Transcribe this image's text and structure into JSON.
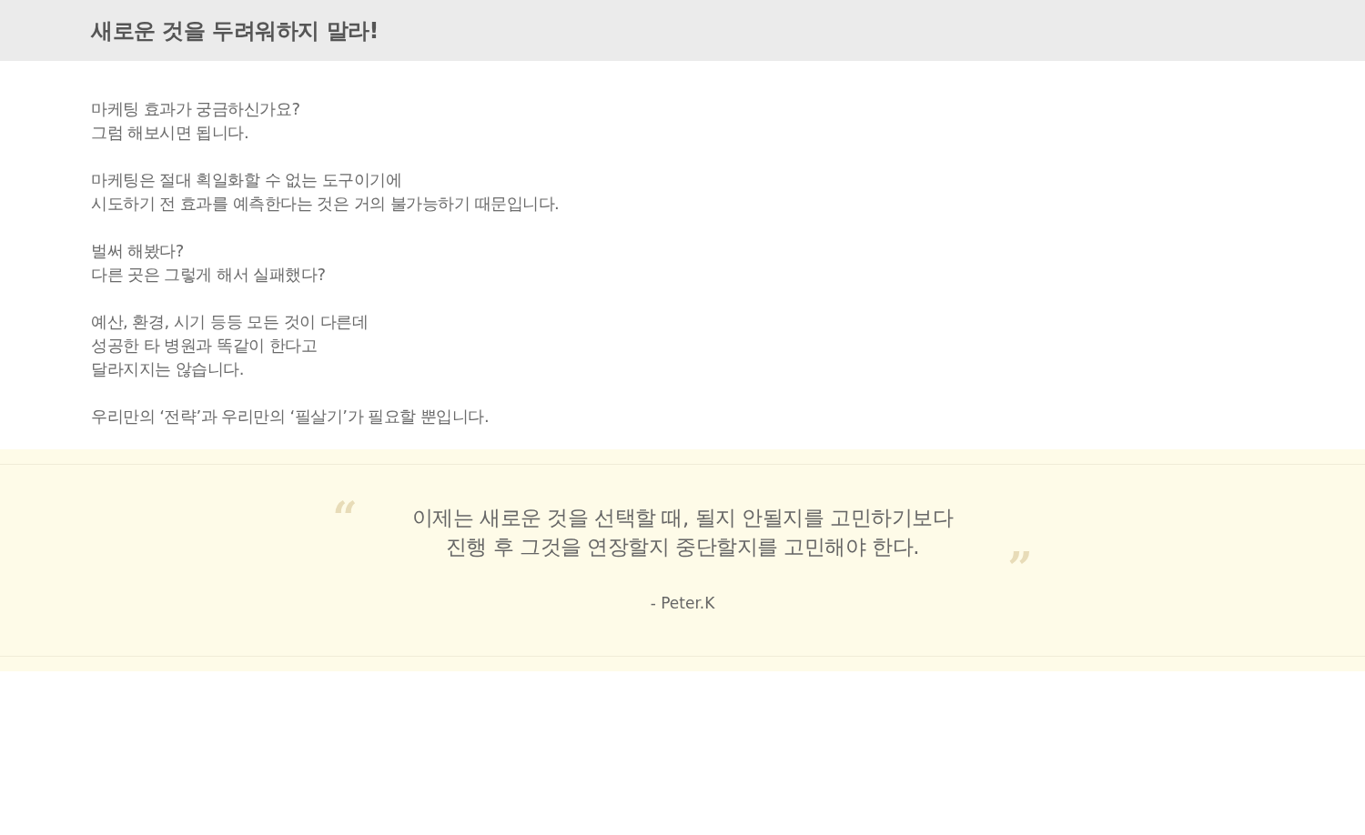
{
  "header": {
    "title": "새로운 것을 두려워하지 말라!"
  },
  "paragraphs": [
    [
      "마케팅 효과가 궁금하신가요?",
      "그럼 해보시면 됩니다."
    ],
    [
      "마케팅은 절대 획일화할 수 없는 도구이기에",
      "시도하기 전 효과를 예측한다는 것은 거의 불가능하기 때문입니다."
    ],
    [
      "벌써 해봤다?",
      "다른 곳은 그렇게 해서 실패했다?"
    ],
    [
      "예산, 환경, 시기 등등 모든 것이 다른데",
      "성공한 타 병원과 똑같이 한다고",
      "달라지지는 않습니다."
    ],
    [
      "우리만의 ‘전략’과 우리만의 ‘필살기’가 필요할 뿐입니다."
    ]
  ],
  "quote": {
    "open_mark": "“",
    "lines": [
      "이제는 새로운 것을 선택할 때, 될지 안될지를 고민하기보다",
      "진행 후 그것을 연장할지 중단할지를 고민해야 한다."
    ],
    "close_mark": "”",
    "author": "- Peter.K"
  }
}
